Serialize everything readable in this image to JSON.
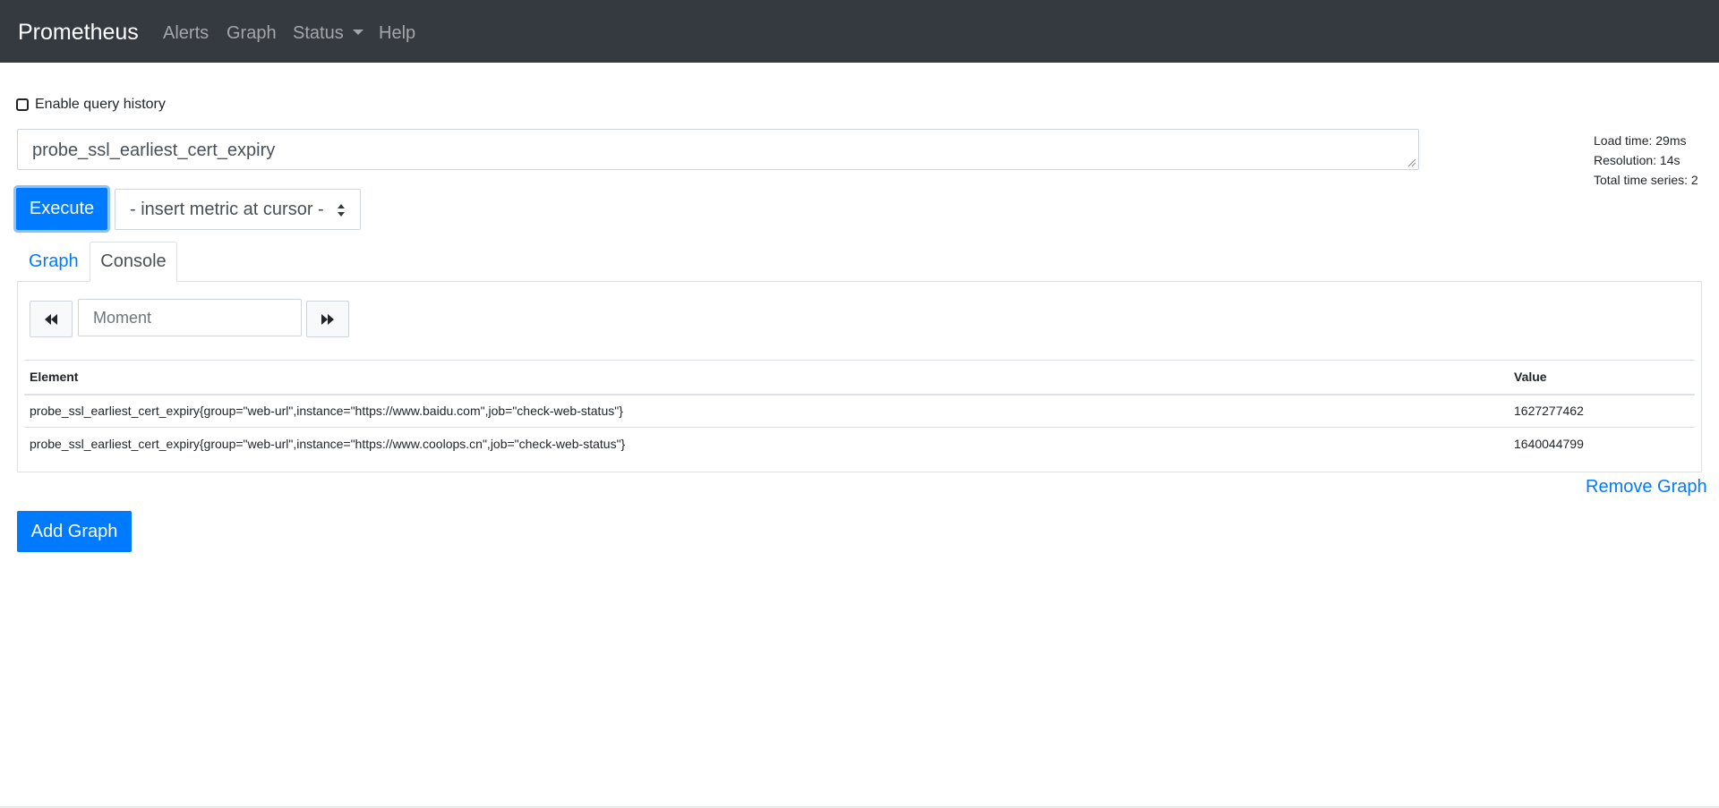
{
  "navbar": {
    "brand": "Prometheus",
    "items": [
      "Alerts",
      "Graph",
      "Status",
      "Help"
    ]
  },
  "history": {
    "label": "Enable query history",
    "checked": false
  },
  "query": {
    "value": "probe_ssl_earliest_cert_expiry"
  },
  "stats": {
    "load_time": "Load time: 29ms",
    "resolution": "Resolution: 14s",
    "total_series": "Total time series: 2"
  },
  "controls": {
    "execute_label": "Execute",
    "metric_select": "- insert metric at cursor -"
  },
  "tabs": {
    "graph": "Graph",
    "console": "Console",
    "active": "Console"
  },
  "console": {
    "moment_placeholder": "Moment",
    "table": {
      "headers": [
        "Element",
        "Value"
      ],
      "rows": [
        {
          "element": "probe_ssl_earliest_cert_expiry{group=\"web-url\",instance=\"https://www.baidu.com\",job=\"check-web-status\"}",
          "value": "1627277462"
        },
        {
          "element": "probe_ssl_earliest_cert_expiry{group=\"web-url\",instance=\"https://www.coolops.cn\",job=\"check-web-status\"}",
          "value": "1640044799"
        }
      ]
    }
  },
  "actions": {
    "remove_graph": "Remove Graph",
    "add_graph": "Add Graph"
  },
  "colors": {
    "navbar": "#343a40",
    "primary": "#007bff",
    "border": "#dee2e6"
  },
  "icons": {
    "back": "fast-backward-icon",
    "forward": "fast-forward-icon",
    "select": "sort-arrows-icon"
  }
}
